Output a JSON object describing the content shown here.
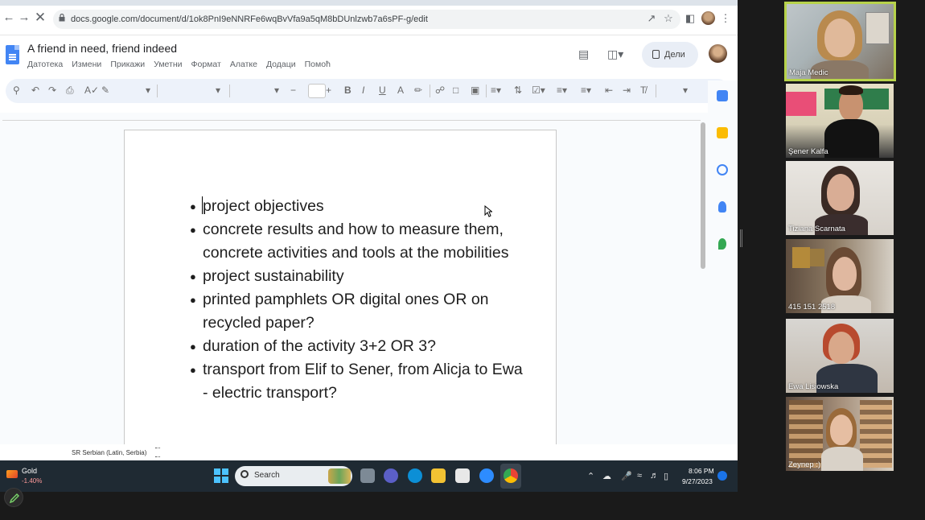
{
  "browser": {
    "url": "docs.google.com/document/d/1ok8PnI9eNNRFe6wqBvVfa9a5qM8bDUnlzwb7a6sPF-g/edit"
  },
  "docs": {
    "title": "A friend in need, friend indeed",
    "menu": [
      "Датотека",
      "Измени",
      "Прикажи",
      "Уметни",
      "Формат",
      "Алатке",
      "Додаци",
      "Помоћ"
    ],
    "share_label": "Дели",
    "bullets": [
      "project objectives",
      "concrete results and how to measure them, concrete activities and tools at the mobilities",
      "project sustainability",
      "printed pamphlets OR digital ones OR on recycled paper?",
      "duration of the activity 3+2 OR 3?",
      "transport from Elif to Sener, from Alicja to Ewa - electric transport?"
    ],
    "language_status": "SR Serbian (Latin, Serbia)"
  },
  "taskbar": {
    "widget_title": "Gold",
    "widget_change": "-1.40%",
    "search_label": "Search",
    "time": "8:06 PM",
    "date": "9/27/2023"
  },
  "participants": [
    {
      "name": "Maja Medic",
      "speaking": true
    },
    {
      "name": "Şener Kalfa",
      "speaking": false
    },
    {
      "name": "Tiziana Scarnata",
      "speaking": false
    },
    {
      "name": "415 151 2518",
      "speaking": false
    },
    {
      "name": "Ewa Lisiowska",
      "speaking": false
    },
    {
      "name": "Zeynep :)",
      "speaking": false
    }
  ],
  "colors": {
    "speaker_highlight": "#b7d24a",
    "docs_blue": "#4285f4",
    "taskbar": "#1f2a33"
  }
}
